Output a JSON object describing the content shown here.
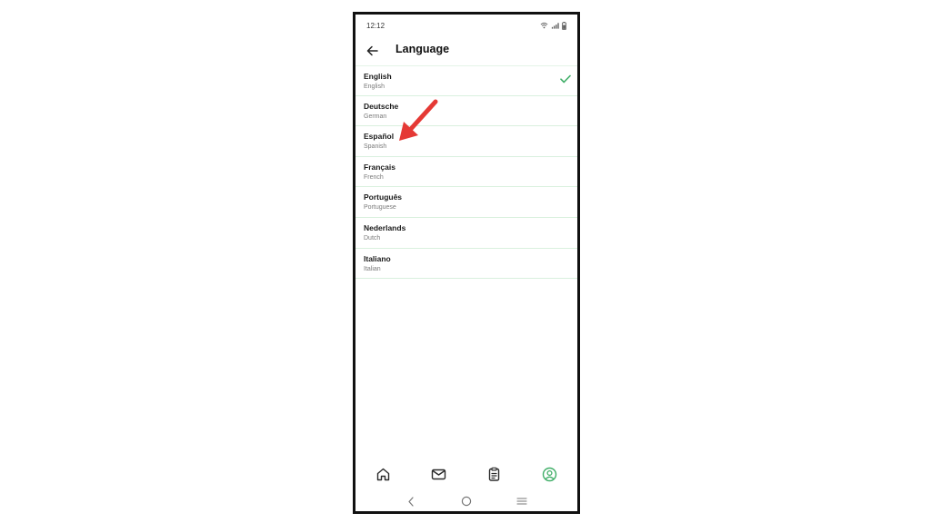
{
  "status_bar": {
    "time": "12:12",
    "icons": [
      "wifi-icon",
      "signal-icon",
      "battery-icon"
    ]
  },
  "header": {
    "back_icon": "arrow-left-icon",
    "title": "Language"
  },
  "languages": [
    {
      "name": "English",
      "subtitle": "English",
      "selected": true
    },
    {
      "name": "Deutsche",
      "subtitle": "German",
      "selected": false
    },
    {
      "name": "Español",
      "subtitle": "Spanish",
      "selected": false
    },
    {
      "name": "Français",
      "subtitle": "French",
      "selected": false
    },
    {
      "name": "Português",
      "subtitle": "Portuguese",
      "selected": false
    },
    {
      "name": "Nederlands",
      "subtitle": "Dutch",
      "selected": false
    },
    {
      "name": "Italiano",
      "subtitle": "Italian",
      "selected": false
    }
  ],
  "bottom_nav": {
    "items": [
      "home-icon",
      "mail-icon",
      "clipboard-icon",
      "profile-icon"
    ],
    "active": "profile-icon"
  },
  "system_nav": [
    "back-icon",
    "home-circle-icon",
    "recents-icon"
  ],
  "colors": {
    "accent": "#3fae67",
    "divider": "#d9f0de",
    "annotation_arrow": "#e53935"
  }
}
